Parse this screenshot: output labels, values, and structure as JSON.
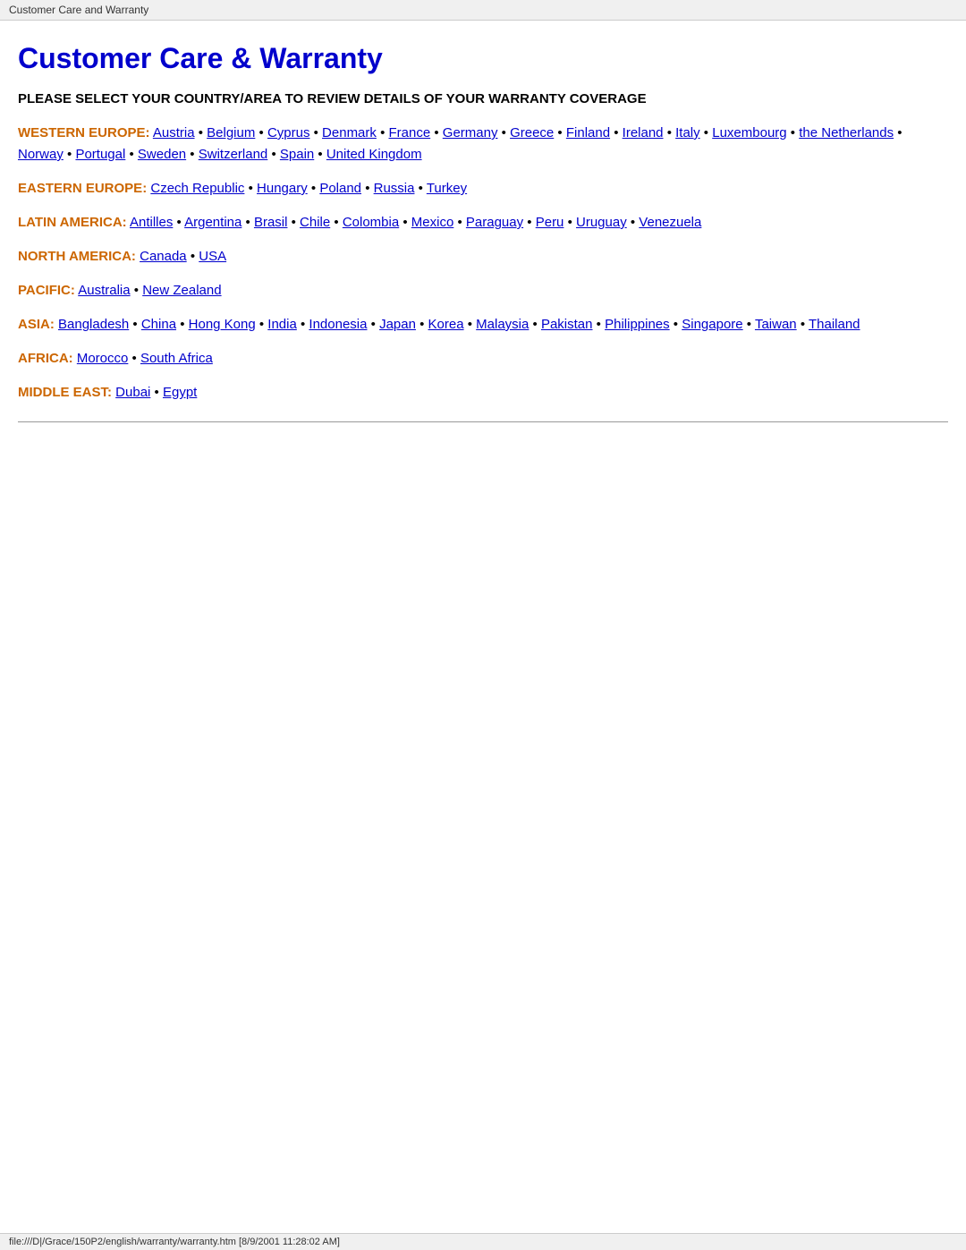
{
  "browser_bar": {
    "title": "Customer Care and Warranty"
  },
  "page": {
    "heading": "Customer Care & Warranty",
    "subtitle": "PLEASE SELECT YOUR COUNTRY/AREA TO REVIEW DETAILS OF YOUR WARRANTY COVERAGE"
  },
  "regions": [
    {
      "id": "western-europe",
      "label": "WESTERN EUROPE:",
      "countries": [
        "Austria",
        "Belgium",
        "Cyprus",
        "Denmark",
        "France",
        "Germany",
        "Greece",
        "Finland",
        "Ireland",
        "Italy",
        "Luxembourg",
        "the Netherlands",
        "Norway",
        "Portugal",
        "Sweden",
        "Switzerland",
        "Spain",
        "United Kingdom"
      ]
    },
    {
      "id": "eastern-europe",
      "label": "EASTERN EUROPE:",
      "countries": [
        "Czech Republic",
        "Hungary",
        "Poland",
        "Russia",
        "Turkey"
      ]
    },
    {
      "id": "latin-america",
      "label": "LATIN AMERICA:",
      "countries": [
        "Antilles",
        "Argentina",
        "Brasil",
        "Chile",
        "Colombia",
        "Mexico",
        "Paraguay",
        "Peru",
        "Uruguay",
        "Venezuela"
      ]
    },
    {
      "id": "north-america",
      "label": "NORTH AMERICA:",
      "countries": [
        "Canada",
        "USA"
      ]
    },
    {
      "id": "pacific",
      "label": "PACIFIC:",
      "countries": [
        "Australia",
        "New Zealand"
      ]
    },
    {
      "id": "asia",
      "label": "ASIA:",
      "countries": [
        "Bangladesh",
        "China",
        "Hong Kong",
        "India",
        "Indonesia",
        "Japan",
        "Korea",
        "Malaysia",
        "Pakistan",
        "Philippines",
        "Singapore",
        "Taiwan",
        "Thailand"
      ]
    },
    {
      "id": "africa",
      "label": "AFRICA:",
      "countries": [
        "Morocco",
        "South Africa"
      ]
    },
    {
      "id": "middle-east",
      "label": "MIDDLE EAST:",
      "countries": [
        "Dubai",
        "Egypt"
      ]
    }
  ],
  "status_bar": {
    "text": "file:///D|/Grace/150P2/english/warranty/warranty.htm [8/9/2001 11:28:02 AM]"
  }
}
